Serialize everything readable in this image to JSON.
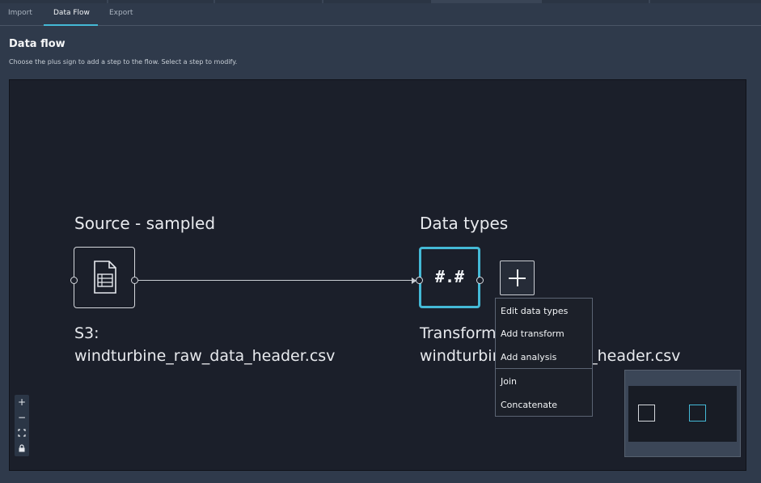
{
  "tabs": [
    {
      "label": "Import"
    },
    {
      "label": "Data Flow",
      "active": true
    },
    {
      "label": "Export"
    }
  ],
  "header": {
    "title": "Data flow",
    "subtitle": "Choose the plus sign to add a step to the flow. Select a step to modify."
  },
  "nodes": {
    "source": {
      "label": "Source - sampled",
      "desc_line1": "S3:",
      "desc_line2": "windturbine_raw_data_header.csv",
      "icon": "document-table-icon"
    },
    "datatypes": {
      "label": "Data types",
      "symbol": "#.#",
      "desc_line1": "Transform",
      "desc_line2": "windturbine_raw_data_header.csv",
      "icon": "number-format-icon"
    }
  },
  "menu": {
    "items": [
      "Edit data types",
      "Add transform",
      "Add analysis",
      "Join",
      "Concatenate"
    ]
  },
  "zoom_controls": {
    "zoom_in": "+",
    "zoom_out": "−"
  },
  "colors": {
    "accent": "#44b9d6",
    "canvas": "#1b1f2a",
    "panel": "#2f3a4b"
  }
}
